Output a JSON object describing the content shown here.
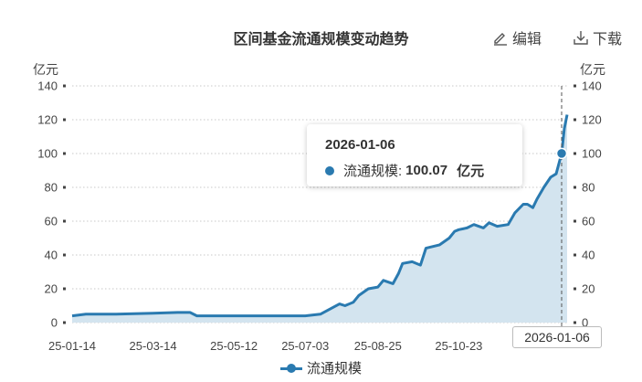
{
  "header": {
    "title": "区间基金流通规模变动趋势",
    "edit_label": "编辑",
    "download_label": "下载"
  },
  "axes": {
    "left_unit": "亿元",
    "right_unit": "亿元"
  },
  "tooltip": {
    "date": "2026-01-06",
    "series_name": "流通规模:",
    "value": "100.07",
    "unit": "亿元"
  },
  "crosshair_label": "2026-01-06",
  "legend": {
    "label": "流通规模"
  },
  "colors": {
    "series": "#2a7ab0",
    "area": "#d3e4ef",
    "grid": "#c8c8c8"
  },
  "chart_data": {
    "type": "area",
    "title": "区间基金流通规模变动趋势",
    "ylabel": "亿元",
    "ylim": [
      0,
      140
    ],
    "yticks": [
      0,
      20,
      40,
      60,
      80,
      100,
      120,
      140
    ],
    "x_tick_labels": [
      "25-01-14",
      "25-03-14",
      "25-05-12",
      "25-07-03",
      "25-08-25",
      "25-10-23"
    ],
    "grid": true,
    "legend_position": "bottom",
    "series": [
      {
        "name": "流通规模",
        "x": [
          "2025-01-14",
          "2025-01-24",
          "2025-02-14",
          "2025-03-14",
          "2025-04-01",
          "2025-04-10",
          "2025-04-15",
          "2025-05-12",
          "2025-06-10",
          "2025-07-03",
          "2025-07-14",
          "2025-07-21",
          "2025-07-28",
          "2025-08-01",
          "2025-08-07",
          "2025-08-11",
          "2025-08-18",
          "2025-08-25",
          "2025-08-29",
          "2025-09-05",
          "2025-09-09",
          "2025-09-12",
          "2025-09-19",
          "2025-09-25",
          "2025-09-29",
          "2025-10-09",
          "2025-10-16",
          "2025-10-20",
          "2025-10-23",
          "2025-10-29",
          "2025-11-03",
          "2025-11-10",
          "2025-11-14",
          "2025-11-20",
          "2025-11-28",
          "2025-12-03",
          "2025-12-09",
          "2025-12-12",
          "2025-12-16",
          "2025-12-19",
          "2025-12-24",
          "2025-12-29",
          "2026-01-02",
          "2026-01-06",
          "2026-01-08",
          "2026-01-10"
        ],
        "y": [
          4,
          5,
          5,
          5.5,
          6,
          6,
          4,
          4,
          4,
          4,
          5,
          8,
          11,
          10,
          12,
          16,
          20,
          21,
          25,
          23,
          29,
          35,
          36,
          34,
          44,
          46,
          50,
          54,
          55,
          56,
          58,
          56,
          59,
          57,
          58,
          65,
          70,
          70,
          68,
          73,
          80,
          86,
          88,
          100.07,
          115,
          123
        ]
      }
    ],
    "highlight": {
      "x": "2026-01-06",
      "y": 100.07
    }
  }
}
